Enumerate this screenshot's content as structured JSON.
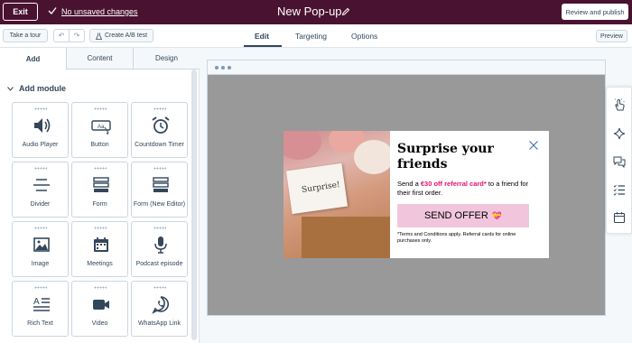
{
  "topbar": {
    "exit_label": "Exit",
    "save_status": "No unsaved changes",
    "title": "New Pop-up",
    "review_label": "Review and publish"
  },
  "subbar": {
    "tour_label": "Take a tour",
    "ab_label": "Create A/B test",
    "tabs": [
      "Edit",
      "Targeting",
      "Options"
    ],
    "active_tab": "Edit",
    "preview_label": "Preview"
  },
  "panel": {
    "tabs": [
      "Add",
      "Content",
      "Design"
    ],
    "active_tab": "Add",
    "section_title": "Add module",
    "modules": [
      {
        "label": "Audio Player",
        "icon": "speaker-icon"
      },
      {
        "label": "Button",
        "icon": "button-icon"
      },
      {
        "label": "Countdown Timer",
        "icon": "alarm-clock-icon"
      },
      {
        "label": "Divider",
        "icon": "divider-icon"
      },
      {
        "label": "Form",
        "icon": "form-icon"
      },
      {
        "label": "Form (New Editor)",
        "icon": "form-icon"
      },
      {
        "label": "Image",
        "icon": "image-icon"
      },
      {
        "label": "Meetings",
        "icon": "calendar-icon"
      },
      {
        "label": "Podcast episode",
        "icon": "microphone-icon"
      },
      {
        "label": "Rich Text",
        "icon": "rich-text-icon"
      },
      {
        "label": "Video",
        "icon": "video-icon"
      },
      {
        "label": "WhatsApp Link",
        "icon": "whatsapp-icon"
      }
    ]
  },
  "popup": {
    "image_card_text": "Surprise!",
    "title": "Surprise your friends",
    "body_before": "Send a ",
    "body_highlight": "€30 off referral card*",
    "body_after": " to a friend for their first order.",
    "button_label": "SEND OFFER",
    "button_emoji": "💝",
    "terms": "*Terms and Conditions apply. Referral cards for online purchases only."
  },
  "colors": {
    "topbar_bg": "#4a1231",
    "highlight": "#e4126b",
    "button_bg": "#f1c6dc",
    "canvas_bg": "#999999"
  }
}
